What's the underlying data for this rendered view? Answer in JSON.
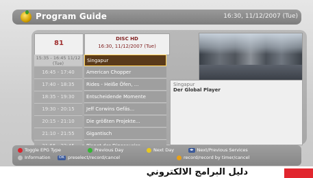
{
  "header": {
    "title": "Program Guide",
    "datetime": "16:30, 11/12/2007 (Tue)"
  },
  "channel": {
    "number": "81",
    "name": "DISC HD",
    "current_time": "16:30, 11/12/2007 (Tue)"
  },
  "programs": [
    {
      "time": "15:35 - 16:45 11/12 (Tue)",
      "title": "Singapur",
      "selected": true
    },
    {
      "time": "16:45 - 17:40",
      "title": "American Chopper"
    },
    {
      "time": "17:40 - 18:35",
      "title": "Rides - Heiße Öfen, ..."
    },
    {
      "time": "18:35 - 19:30",
      "title": "Entscheidende Momente"
    },
    {
      "time": "19:30 - 20:15",
      "title": "Jeff Corwins Gefäs..."
    },
    {
      "time": "20:15 - 21:10",
      "title": "Die größten Projekte..."
    },
    {
      "time": "21:10 - 21:55",
      "title": "Gigantisch"
    },
    {
      "time": "21:55 - 22:45",
      "title": "Planet der Dinosaurier"
    }
  ],
  "info_panel": {
    "line1": "Singapur",
    "line2": "Der Global Player"
  },
  "legend": {
    "toggle": "Toggle EPG Type",
    "prev_day": "Previous Day",
    "next_day": "Next Day",
    "services": "Next/Previous Services",
    "information": "Information",
    "ok_chip": "OK",
    "preselect": "preselect/record/cancel",
    "rec": "record/record by timer/cancel",
    "colors": {
      "red": "#d8262f",
      "green": "#35b535",
      "yellow": "#e8c820",
      "blue": "#3c5a9a"
    }
  },
  "footer": {
    "text": "دليل البرامج الالكتروني"
  }
}
